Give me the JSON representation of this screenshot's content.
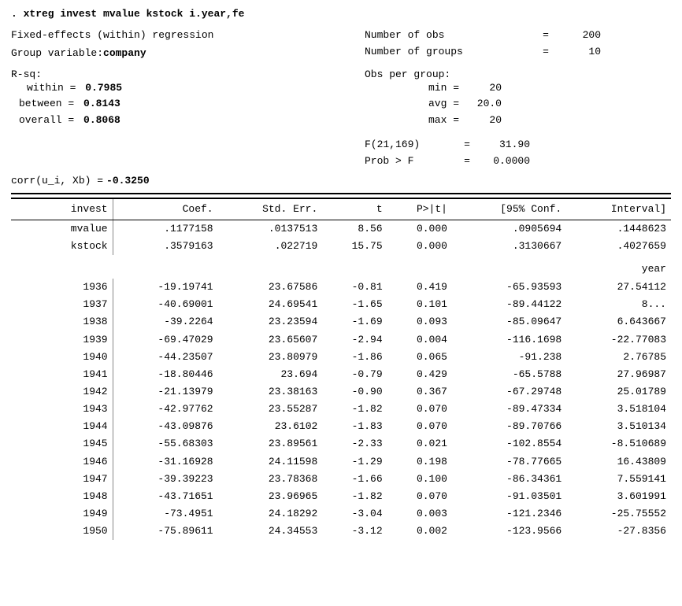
{
  "command": ". xtreg invest mvalue kstock i.year,fe",
  "header": {
    "left": {
      "line1": "Fixed-effects (within) regression",
      "line2_pre": "Group variable: ",
      "line2_bold": "company"
    },
    "right": {
      "nobs_label": "Number of obs",
      "nobs_eq": "=",
      "nobs_val": "200",
      "ngroups_label": "Number of groups",
      "ngroups_eq": "=",
      "ngroups_val": "10"
    }
  },
  "rsq": {
    "label": "R-sq:",
    "obs_per_group": "Obs per group:",
    "within_label": "within  =",
    "within_val": "0.7985",
    "between_label": "between =",
    "between_val": "0.8143",
    "overall_label": "overall =",
    "overall_val": "0.8068",
    "min_label": "min =",
    "min_val": "20",
    "avg_label": "avg =",
    "avg_val": "20.0",
    "max_label": "max =",
    "max_val": "20"
  },
  "stats": {
    "f_label": "F(21,169)",
    "f_eq": "=",
    "f_val": "31.90",
    "prob_label": "Prob > F",
    "prob_eq": "=",
    "prob_val": "0.0000"
  },
  "corr": {
    "label": "corr(u_i, Xb)  =",
    "val": "-0.3250"
  },
  "table": {
    "headers": [
      "invest",
      "Coef.",
      "Std. Err.",
      "t",
      "P>|t|",
      "[95% Conf.",
      "Interval]"
    ],
    "rows": [
      {
        "name": "mvalue",
        "coef": ".1177158",
        "se": ".0137513",
        "t": "8.56",
        "p": "0.000",
        "ci_low": ".0905694",
        "ci_hi": ".1448623"
      },
      {
        "name": "kstock",
        "coef": ".3579163",
        "se": ".022719",
        "t": "15.75",
        "p": "0.000",
        "ci_low": ".3130667",
        "ci_hi": ".4027659"
      },
      {
        "name": "year",
        "coef": "",
        "se": "",
        "t": "",
        "p": "",
        "ci_low": "",
        "ci_hi": ""
      },
      {
        "name": "1936",
        "coef": "-19.19741",
        "se": "23.67586",
        "t": "-0.81",
        "p": "0.419",
        "ci_low": "-65.93593",
        "ci_hi": "27.54112"
      },
      {
        "name": "1937",
        "coef": "-40.69001",
        "se": "24.69541",
        "t": "-1.65",
        "p": "0.101",
        "ci_low": "-89.44122",
        "ci_hi": "8..."
      },
      {
        "name": "1938",
        "coef": "-39.2264",
        "se": "23.23594",
        "t": "-1.69",
        "p": "0.093",
        "ci_low": "-85.09647",
        "ci_hi": "6.643667"
      },
      {
        "name": "1939",
        "coef": "-69.47029",
        "se": "23.65607",
        "t": "-2.94",
        "p": "0.004",
        "ci_low": "-116.1698",
        "ci_hi": "-22.77083"
      },
      {
        "name": "1940",
        "coef": "-44.23507",
        "se": "23.80979",
        "t": "-1.86",
        "p": "0.065",
        "ci_low": "-91.238",
        "ci_hi": "2.76785"
      },
      {
        "name": "1941",
        "coef": "-18.80446",
        "se": "23.694",
        "t": "-0.79",
        "p": "0.429",
        "ci_low": "-65.5788",
        "ci_hi": "27.96987"
      },
      {
        "name": "1942",
        "coef": "-21.13979",
        "se": "23.38163",
        "t": "-0.90",
        "p": "0.367",
        "ci_low": "-67.29748",
        "ci_hi": "25.01789"
      },
      {
        "name": "1943",
        "coef": "-42.97762",
        "se": "23.55287",
        "t": "-1.82",
        "p": "0.070",
        "ci_low": "-89.47334",
        "ci_hi": "3.518104"
      },
      {
        "name": "1944",
        "coef": "-43.09876",
        "se": "23.6102",
        "t": "-1.83",
        "p": "0.070",
        "ci_low": "-89.70766",
        "ci_hi": "3.510134"
      },
      {
        "name": "1945",
        "coef": "-55.68303",
        "se": "23.89561",
        "t": "-2.33",
        "p": "0.021",
        "ci_low": "-102.8554",
        "ci_hi": "-8.510689"
      },
      {
        "name": "1946",
        "coef": "-31.16928",
        "se": "24.11598",
        "t": "-1.29",
        "p": "0.198",
        "ci_low": "-78.77665",
        "ci_hi": "16.43809"
      },
      {
        "name": "1947",
        "coef": "-39.39223",
        "se": "23.78368",
        "t": "-1.66",
        "p": "0.100",
        "ci_low": "-86.34361",
        "ci_hi": "7.559141"
      },
      {
        "name": "1948",
        "coef": "-43.71651",
        "se": "23.96965",
        "t": "-1.82",
        "p": "0.070",
        "ci_low": "-91.03501",
        "ci_hi": "3.601991"
      },
      {
        "name": "1949",
        "coef": "-73.4951",
        "se": "24.18292",
        "t": "-3.04",
        "p": "0.003",
        "ci_low": "-121.2346",
        "ci_hi": "-25.75552"
      },
      {
        "name": "1950",
        "coef": "-75.89611",
        "se": "24.34553",
        "t": "-3.12",
        "p": "0.002",
        "ci_low": "-123.9566",
        "ci_hi": "-27.8356"
      }
    ]
  }
}
